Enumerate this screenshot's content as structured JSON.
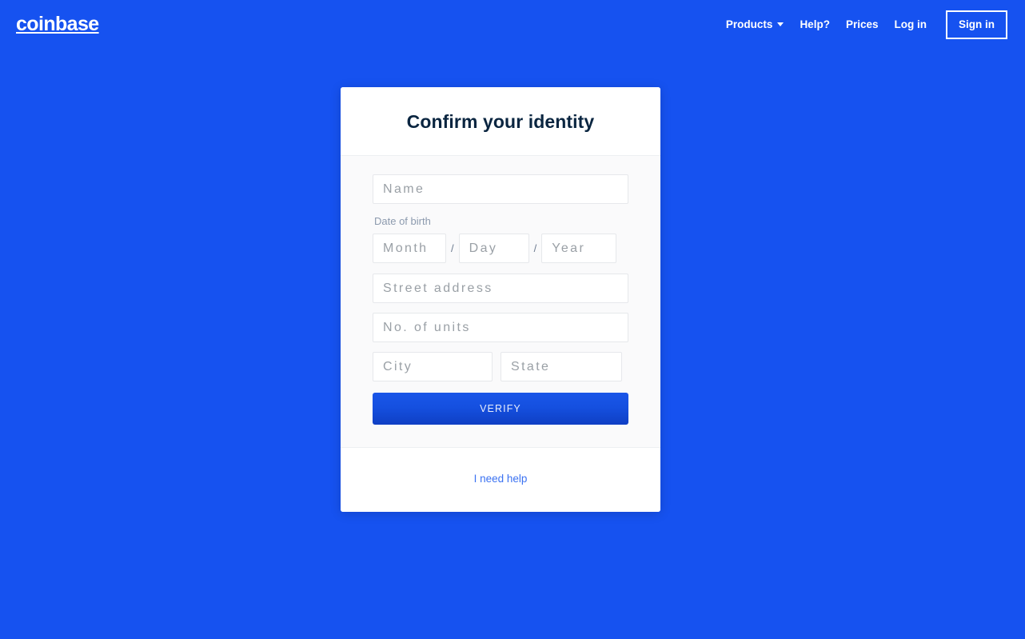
{
  "page": {
    "background_color": "#1652f0"
  },
  "navbar": {
    "brand": "coinbase",
    "links": [
      {
        "label": "Products",
        "has_caret": true,
        "icon": "chevron-down-icon"
      },
      {
        "label": "Help?",
        "has_caret": false
      },
      {
        "label": "Prices",
        "has_caret": false
      },
      {
        "label": "Log in",
        "has_caret": false
      }
    ],
    "signin_label": "Sign in"
  },
  "card": {
    "title": "Confirm your identity",
    "form": {
      "name_placeholder": "Name",
      "name_value": "",
      "dob_label": "Date of birth",
      "dob_separator": "/",
      "month_placeholder": "Month",
      "month_value": "",
      "day_placeholder": "Day",
      "day_value": "",
      "year_placeholder": "Year",
      "year_value": "",
      "street_placeholder": "Street address",
      "street_value": "",
      "units_placeholder": "No. of units",
      "units_value": "",
      "city_placeholder": "City",
      "city_value": "",
      "state_placeholder": "State",
      "state_value": "",
      "submit_label": "VERIFY"
    },
    "footer": {
      "help_label": "I need help"
    }
  },
  "colors": {
    "brand_blue": "#1652f0",
    "button_blue": "#1550e0",
    "link_blue": "#3b72f2",
    "title_navy": "#0a2540",
    "label_gray": "#8c9aae",
    "placeholder_gray": "#9aa0a6"
  }
}
